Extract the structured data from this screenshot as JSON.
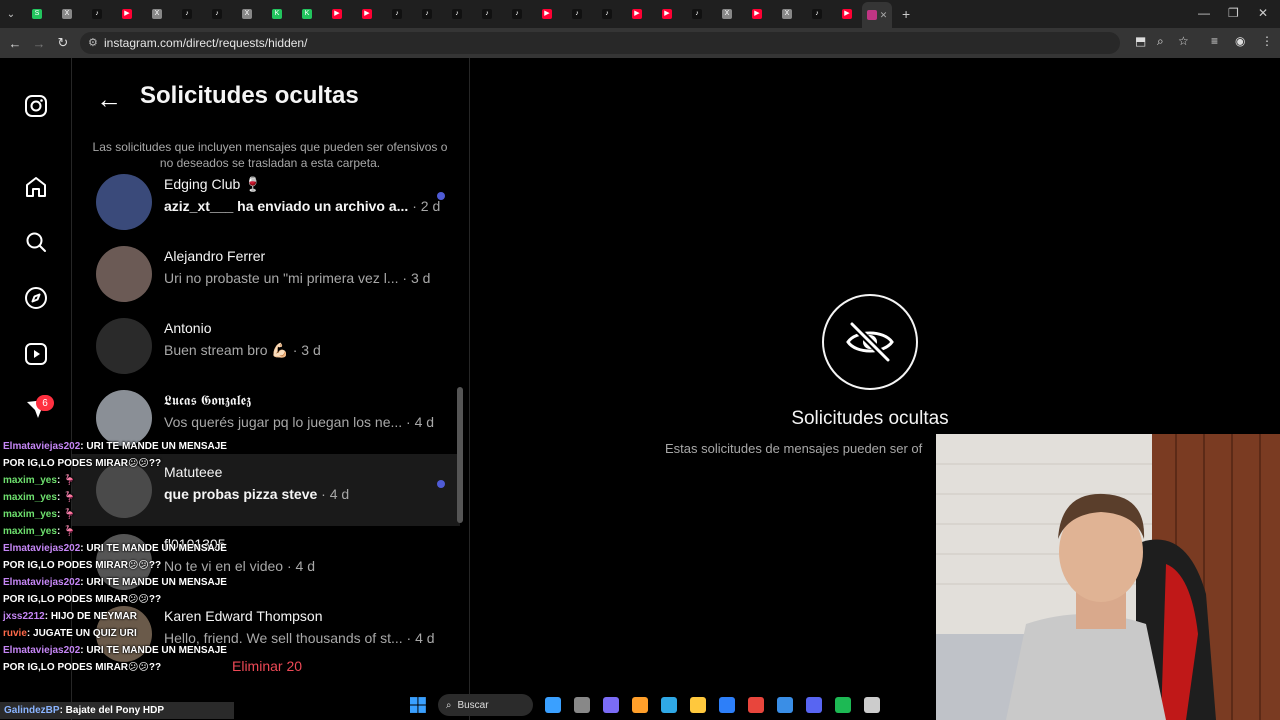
{
  "browser": {
    "url": "instagram.com/direct/requests/hidden/",
    "tabs": [
      {
        "label": "S",
        "color": "#22c55e"
      },
      {
        "label": "X",
        "color": "#888888"
      },
      {
        "label": "♪",
        "color": "#111111"
      },
      {
        "label": "▶",
        "color": "#ff0033"
      },
      {
        "label": "X",
        "color": "#888888"
      },
      {
        "label": "♪",
        "color": "#111111"
      },
      {
        "label": "♪",
        "color": "#111111"
      },
      {
        "label": "X",
        "color": "#888888"
      },
      {
        "label": "K",
        "color": "#22c55e"
      },
      {
        "label": "K",
        "color": "#22c55e"
      },
      {
        "label": "▶",
        "color": "#ff0033"
      },
      {
        "label": "▶",
        "color": "#ff0033"
      },
      {
        "label": "♪",
        "color": "#111111"
      },
      {
        "label": "♪",
        "color": "#111111"
      },
      {
        "label": "♪",
        "color": "#111111"
      },
      {
        "label": "♪",
        "color": "#111111"
      },
      {
        "label": "♪",
        "color": "#111111"
      },
      {
        "label": "▶",
        "color": "#ff0033"
      },
      {
        "label": "♪",
        "color": "#111111"
      },
      {
        "label": "♪",
        "color": "#111111"
      },
      {
        "label": "▶",
        "color": "#ff0033"
      },
      {
        "label": "▶",
        "color": "#ff0033"
      },
      {
        "label": "♪",
        "color": "#111111"
      },
      {
        "label": "X",
        "color": "#888888"
      },
      {
        "label": "▶",
        "color": "#ff0033"
      },
      {
        "label": "X",
        "color": "#888888"
      },
      {
        "label": "♪",
        "color": "#111111"
      },
      {
        "label": "▶",
        "color": "#ff0033"
      }
    ]
  },
  "nav": {
    "items": [
      {
        "name": "instagram-logo-icon",
        "glyph": "logo"
      },
      {
        "name": "home-icon",
        "glyph": "home"
      },
      {
        "name": "search-icon",
        "glyph": "search"
      },
      {
        "name": "explore-icon",
        "glyph": "explore"
      },
      {
        "name": "reels-icon",
        "glyph": "reels"
      },
      {
        "name": "messages-icon",
        "glyph": "messages"
      }
    ],
    "badge": "6"
  },
  "panel": {
    "title": "Solicitudes ocultas",
    "notice": "Las solicitudes que incluyen mensajes que pueden ser ofensivos o no deseados se trasladan a esta carpeta.",
    "delete_all": "Eliminar 20"
  },
  "requests": [
    {
      "name": "Edging Club 🍷",
      "message": "aziz_xt___ ha enviado un archivo a...",
      "time": " · 2 d",
      "unread": true,
      "avatar": "#3a4a7a"
    },
    {
      "name": "Alejandro Ferrer",
      "message": "Uri no probaste un \"mi primera vez l...",
      "time": " · 3 d",
      "unread": false,
      "avatar": "#6b5a55"
    },
    {
      "name": "Antonio",
      "message": "Buen stream bro 💪🏻",
      "time": " · 3 d",
      "unread": false,
      "avatar": "#2a2a2a"
    },
    {
      "name": "𝕷𝖚𝖈𝖆𝖘 𝕲𝖔𝖓𝖟𝖆𝖑𝖊𝖟",
      "message": "Vos querés jugar pq lo juegan los ne...",
      "time": " · 4 d",
      "unread": false,
      "avatar": "#8a8f96"
    },
    {
      "name": "Matuteee",
      "message": "que probas pizza steve",
      "time": " · 4 d",
      "unread": true,
      "avatar": "#4a4a4a"
    },
    {
      "name": "fl0101305",
      "message": "No te vi en el video",
      "time": " · 4 d",
      "unread": false,
      "avatar": "#555555"
    },
    {
      "name": "Karen Edward Thompson",
      "message": "Hello, friend. We sell thousands of st...",
      "time": " · 4 d",
      "unread": false,
      "avatar": "#6a5a4a"
    }
  ],
  "empty_state": {
    "title": "Solicitudes ocultas",
    "subtitle": "Estas solicitudes de mensajes pueden ser of"
  },
  "chat": [
    {
      "user": "Elmataviejas202",
      "text": ": URI TE MANDE UN MENSAJE",
      "color": "purple"
    },
    {
      "user": "",
      "text": "POR IG,LO PODES MIRAR😕😕??",
      "color": "purple"
    },
    {
      "user": "maxim_yes",
      "text": ": 🦩",
      "color": "green"
    },
    {
      "user": "maxim_yes",
      "text": ": 🦩",
      "color": "green"
    },
    {
      "user": "maxim_yes",
      "text": ": 🦩",
      "color": "green"
    },
    {
      "user": "maxim_yes",
      "text": ": 🦩",
      "color": "green"
    },
    {
      "user": "Elmataviejas202",
      "text": ": URI TE MANDE UN MENSAJE",
      "color": "purple"
    },
    {
      "user": "",
      "text": "POR IG,LO PODES MIRAR😕😕??",
      "color": "purple"
    },
    {
      "user": "Elmataviejas202",
      "text": ": URI TE MANDE UN MENSAJE",
      "color": "purple"
    },
    {
      "user": "",
      "text": "POR IG,LO PODES MIRAR😕😕??",
      "color": "purple"
    },
    {
      "user": "jxss2212",
      "text": ": HIJO DE NEYMAR",
      "color": "purple"
    },
    {
      "user": "ruvie",
      "text": ": JUGATE UN QUIZ URI",
      "color": "red"
    },
    {
      "user": "Elmataviejas202",
      "text": ": URI TE MANDE UN MENSAJE",
      "color": "purple"
    },
    {
      "user": "",
      "text": "POR IG,LO PODES MIRAR😕😕??",
      "color": "purple"
    }
  ],
  "chat_last": {
    "user": "GalindezBP",
    "text": ": Bajate del Pony HDP"
  },
  "taskbar": {
    "search_label": "Buscar",
    "apps": [
      "#3aa0ff",
      "#888888",
      "#7b6cf6",
      "#ff9f2a",
      "#2fa8e6",
      "#ffc83d",
      "#2d7ff9",
      "#e8453c",
      "#3a8ee6",
      "#5865f2",
      "#1db954",
      "#cccccc"
    ]
  }
}
